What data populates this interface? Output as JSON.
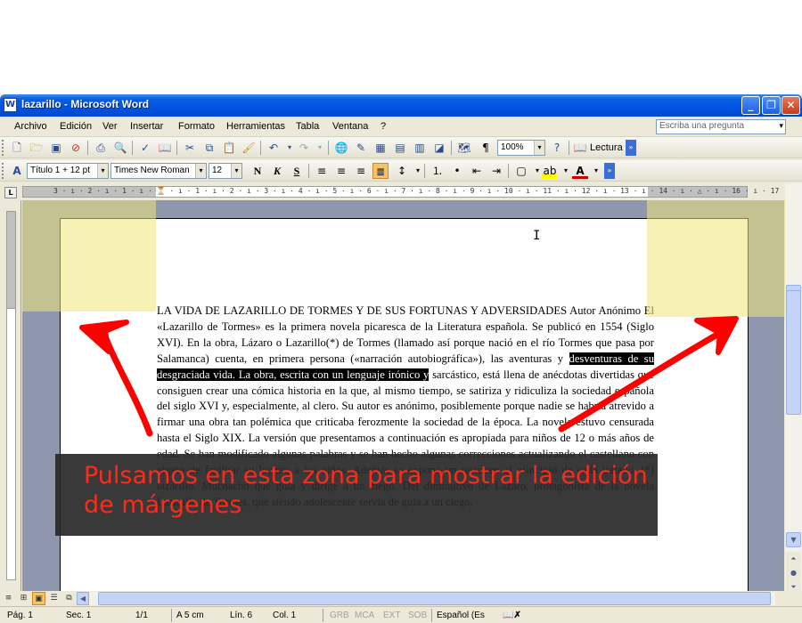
{
  "window": {
    "title": "lazarillo - Microsoft Word",
    "minimize": "_",
    "restore": "❐",
    "close": "✕"
  },
  "menu": {
    "items": [
      "Archivo",
      "Edición",
      "Ver",
      "Insertar",
      "Formato",
      "Herramientas",
      "Tabla",
      "Ventana",
      "?"
    ],
    "ask_placeholder": "Escriba una pregunta"
  },
  "standard_toolbar": {
    "zoom": "100%",
    "reading_label": "Lectura"
  },
  "format_toolbar": {
    "style": "Título 1 + 12 pt",
    "font": "Times New Roman",
    "size": "12",
    "bold": "N",
    "italic": "K",
    "underline": "S"
  },
  "ruler": {
    "numbers": "3 · ı · 2 · ı · 1 · ı · ⏳ · ı · 1 · ı · 2 · ı · 3 · ı · 4 · ı · 5 · ı · 6 · ı · 7 · ı · 8 · ı · 9 · ı · 10 · ı · 11 · ı · 12 · ı · 13 · ı · 14 · ı · △ · ı · 16 · ı · 17 · ı"
  },
  "document": {
    "line1_pre": "LA VIDA DE LAZARILLO DE TORMES Y DE SUS FORTUNAS Y ADVERSIDADES Autor Anónimo El «Lazarillo de Tormes» es la primera novela picaresca de la Literatura española. Se publicó en 1554 (Siglo XVI). En la obra, Lázaro o Lazarillo(*) de Tormes (llamado así porque nació en el río Tormes que pasa por Salamanca) cuenta, en primera persona («narración autobiográfica»), las aventuras y ",
    "highlighted": "desventuras de su desgraciada vida. La obra, escrita con un lenguaje irónico y",
    "line1_post": " sarcástico, está llena de anécdotas divertidas que consiguen crear una cómica historia en la que, al mismo tiempo, se satiriza y ridiculiza la sociedad española del siglo XVI y, especialmente, al clero. Su autor es anónimo, posiblemente porque nadie se habría atrevido a firmar una obra tan polémica que criticaba ferozmente la sociedad de la época. La novela estuvo censurada hasta el Siglo XIX. La versión que presentamos a continuación es apropiada para niños de 12 o más años de edad. Se han modificado algunas palabras y se han hecho algunas correcciones actualizando el castellano con objeto de facilitar su lectura a los niños. Además se expone un resumen al principio de cada tratado. (*) lazarillo. Muchacho que guía y dirige a un ciego. Del diminutivo de Lázaro, protagonista de la novela Lazarillo de Tormes, que siendo adolescente servía de guía a un ciego."
  },
  "annotation": {
    "text": "Pulsamos en esta zona para mostrar la edición de márgenes",
    "text_color": "#ff2a1a",
    "highlight_color": "#f0e678"
  },
  "status": {
    "page": "Pág. 1",
    "section": "Sec. 1",
    "pages": "1/1",
    "at": "A 5 cm",
    "line": "Lín. 6",
    "col": "Col. 1",
    "grb": "GRB",
    "mca": "MCA",
    "ext": "EXT",
    "sob": "SOB",
    "language": "Español (Es"
  }
}
